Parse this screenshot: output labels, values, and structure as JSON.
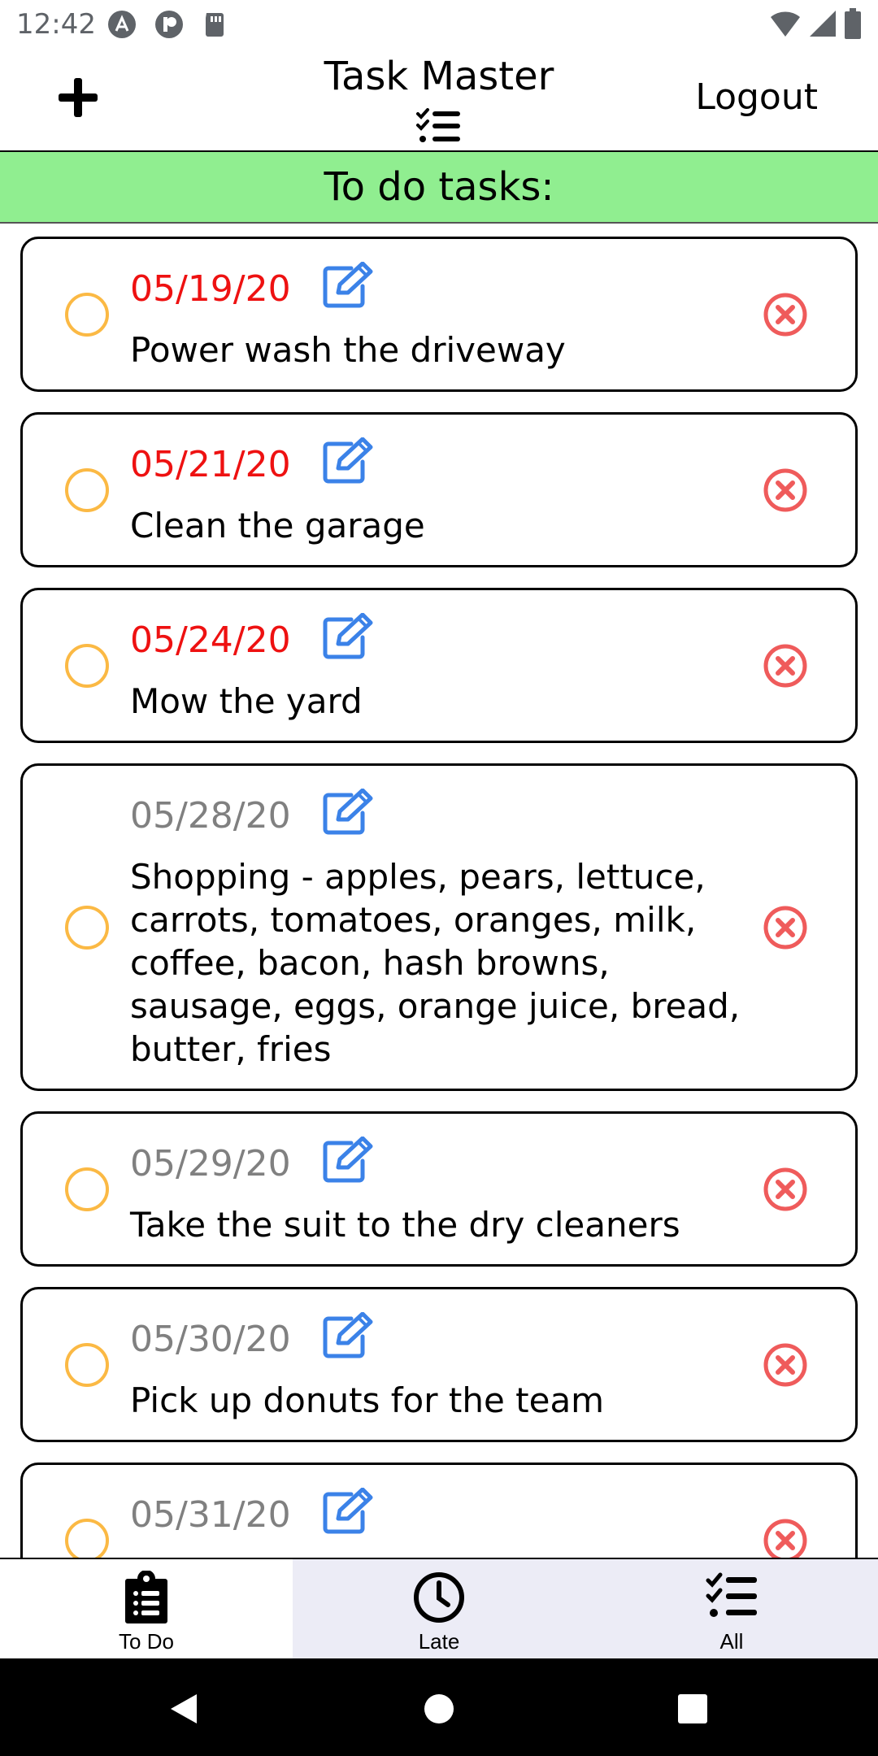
{
  "status_bar": {
    "time": "12:42",
    "left_icons": [
      "a-icon",
      "p-icon",
      "sd-card-icon"
    ],
    "right_icons": [
      "wifi-icon",
      "signal-icon",
      "battery-icon"
    ]
  },
  "header": {
    "title": "Task Master",
    "logout_label": "Logout",
    "add_icon": "plus-icon",
    "center_icon": "list-check-icon"
  },
  "section": {
    "title": "To do tasks:",
    "color": "#90ee90"
  },
  "tasks": [
    {
      "date": "05/19/20",
      "text": "Power wash the driveway",
      "late": true
    },
    {
      "date": "05/21/20",
      "text": "Clean the garage",
      "late": true
    },
    {
      "date": "05/24/20",
      "text": "Mow the yard",
      "late": true
    },
    {
      "date": "05/28/20",
      "text": "Shopping - apples, pears, lettuce, carrots, tomatoes, oranges, milk, coffee, bacon, hash browns, sausage, eggs, orange juice, bread, butter, fries",
      "late": false
    },
    {
      "date": "05/29/20",
      "text": "Take the suit to the dry cleaners",
      "late": false
    },
    {
      "date": "05/30/20",
      "text": "Pick up donuts for the team",
      "late": false
    },
    {
      "date": "05/31/20",
      "text": "",
      "late": false
    }
  ],
  "tabs": [
    {
      "label": "To Do",
      "icon": "clipboard-list-icon",
      "active": true
    },
    {
      "label": "Late",
      "icon": "clock-icon",
      "active": false
    },
    {
      "label": "All",
      "icon": "list-check-icon",
      "active": false
    }
  ],
  "colors": {
    "late_date": "#ee1111",
    "normal_date": "#808080",
    "radio": "#fbb944",
    "edit": "#3b82e8",
    "delete": "#ef5b5b"
  },
  "nav_bar": {
    "icons": [
      "back-icon",
      "home-icon",
      "recents-icon"
    ]
  }
}
